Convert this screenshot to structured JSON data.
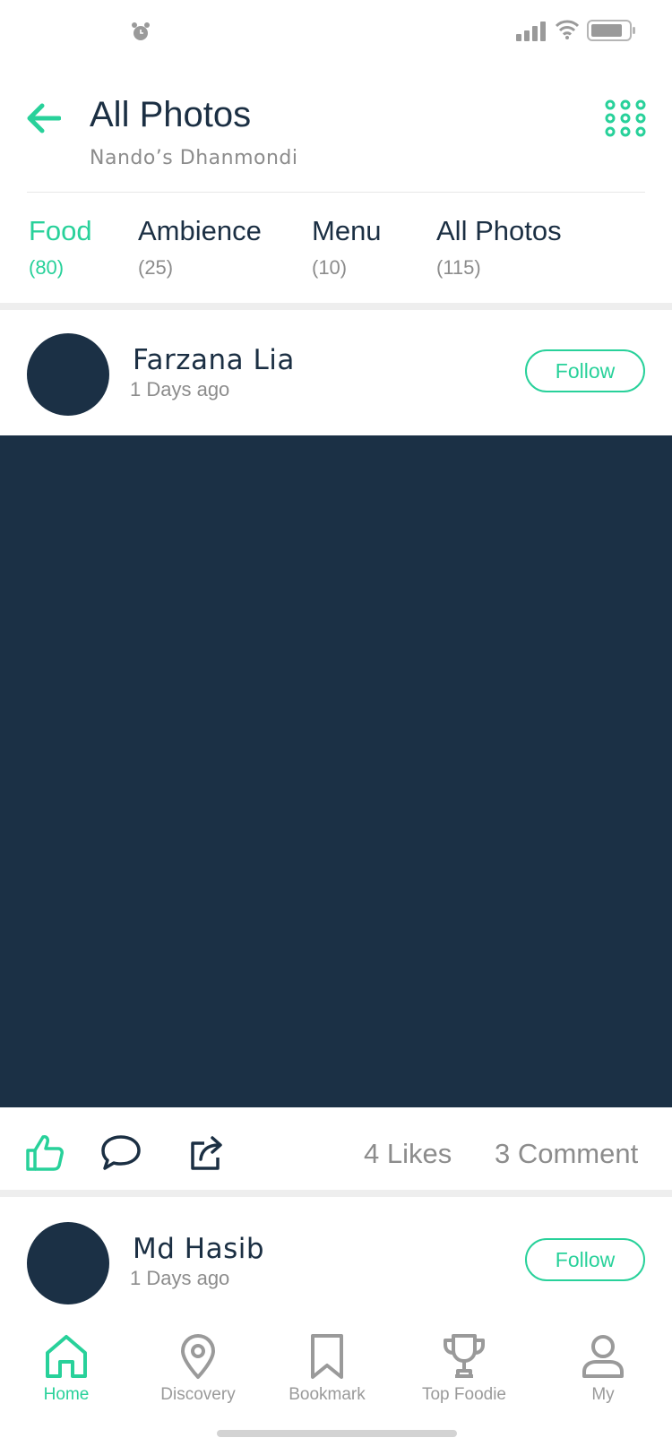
{
  "colors": {
    "accent": "#28d19a",
    "dark": "#1b3045",
    "muted": "#8c8c8c"
  },
  "header": {
    "title": "All Photos",
    "subtitle": "Nando’s Dhanmondi",
    "back_icon": "arrow-left-icon",
    "menu_icon": "grid-dots-icon"
  },
  "tabs": [
    {
      "label": "Food",
      "count": "(80)",
      "active": true
    },
    {
      "label": "Ambience",
      "count": "(25)"
    },
    {
      "label": "Menu",
      "count": "(10)"
    },
    {
      "label": "All Photos",
      "count": "(115)"
    }
  ],
  "posts": [
    {
      "author": "Farzana Lia",
      "time": "1 Days ago",
      "follow_label": "Follow",
      "likes": "4 Likes",
      "comments": "3 Comment"
    },
    {
      "author": "Md Hasib",
      "time": "1 Days ago",
      "follow_label": "Follow"
    }
  ],
  "bottom_nav": [
    {
      "label": "Home",
      "icon": "home-icon",
      "active": true
    },
    {
      "label": "Discovery",
      "icon": "map-pin-icon"
    },
    {
      "label": "Bookmark",
      "icon": "bookmark-icon"
    },
    {
      "label": "Top Foodie",
      "icon": "trophy-icon"
    },
    {
      "label": "My",
      "icon": "user-icon"
    }
  ]
}
